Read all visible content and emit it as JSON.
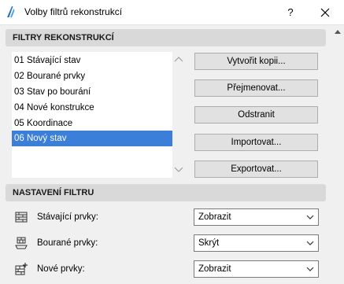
{
  "window": {
    "title": "Volby filtrů rekonstrukcí",
    "help_label": "?"
  },
  "filters_section": {
    "header": "FILTRY REKONSTRUKCÍ",
    "items": [
      {
        "label": "01 Stávající stav",
        "selected": false
      },
      {
        "label": "02 Bourané prvky",
        "selected": false
      },
      {
        "label": "03 Stav po bourání",
        "selected": false
      },
      {
        "label": "04 Nové konstrukce",
        "selected": false
      },
      {
        "label": "05 Koordinace",
        "selected": false
      },
      {
        "label": "06 Nový stav",
        "selected": true
      }
    ],
    "buttons": {
      "duplicate": "Vytvořit kopii...",
      "rename": "Přejmenovat...",
      "delete": "Odstranit",
      "import": "Importovat...",
      "export": "Exportovat..."
    }
  },
  "settings_section": {
    "header": "NASTAVENÍ FILTRU",
    "rows": [
      {
        "label": "Stávající prvky:",
        "value": "Zobrazit",
        "icon": "existing-elements-icon"
      },
      {
        "label": "Bourané prvky:",
        "value": "Skrýt",
        "icon": "demolished-elements-icon"
      },
      {
        "label": "Nové prvky:",
        "value": "Zobrazit",
        "icon": "new-elements-icon"
      }
    ]
  },
  "colors": {
    "selection": "#3c7fd8",
    "header_bg": "#d9d9d9",
    "window_bg": "#f0f0f0"
  }
}
